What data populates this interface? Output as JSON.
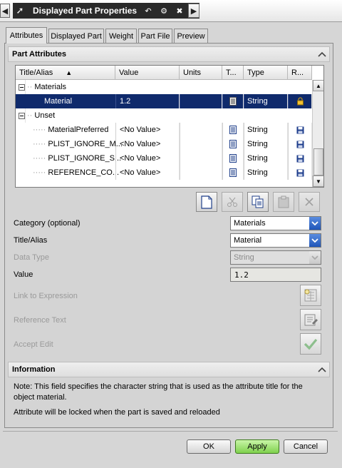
{
  "window": {
    "title": "Displayed Part Properties"
  },
  "tabs": [
    {
      "label": "Attributes"
    },
    {
      "label": "Displayed Part"
    },
    {
      "label": "Weight"
    },
    {
      "label": "Part File"
    },
    {
      "label": "Preview"
    }
  ],
  "part_attributes": {
    "header": "Part Attributes",
    "columns": [
      "Title/Alias",
      "Value",
      "Units",
      "T...",
      "Type",
      "R..."
    ],
    "groups": [
      {
        "label": "Materials"
      },
      {
        "label": "Unset"
      }
    ],
    "rows": [
      {
        "title": "Material",
        "value": "1.2",
        "units": "",
        "type": "String",
        "lock": "lock-icon",
        "selected": true
      },
      {
        "title": "MaterialPreferred",
        "value": "<No Value>",
        "units": "",
        "type": "String",
        "lock": "save-icon"
      },
      {
        "title": "PLIST_IGNORE_M...",
        "value": "<No Value>",
        "units": "",
        "type": "String",
        "lock": "save-icon"
      },
      {
        "title": "PLIST_IGNORE_S...",
        "value": "<No Value>",
        "units": "",
        "type": "String",
        "lock": "save-icon"
      },
      {
        "title": "REFERENCE_CO...",
        "value": "<No Value>",
        "units": "",
        "type": "String",
        "lock": "save-icon"
      }
    ]
  },
  "form": {
    "category_label": "Category (optional)",
    "category_value": "Materials",
    "title_label": "Title/Alias",
    "title_value": "Material",
    "datatype_label": "Data Type",
    "datatype_value": "String",
    "value_label": "Value",
    "value_value": "1.2",
    "link_label": "Link to Expression",
    "reference_label": "Reference Text",
    "accept_label": "Accept Edit"
  },
  "information": {
    "header": "Information",
    "note": "Note: This field specifies the character string that is used as the attribute title for the object material.",
    "lock_note": "Attribute will be locked when the part is saved and reloaded"
  },
  "footer": {
    "ok": "OK",
    "apply": "Apply",
    "cancel": "Cancel"
  },
  "colors": {
    "selection": "#0f2a6c",
    "apply_button": "#7fd14e",
    "combo_button": "#1f55b8"
  }
}
